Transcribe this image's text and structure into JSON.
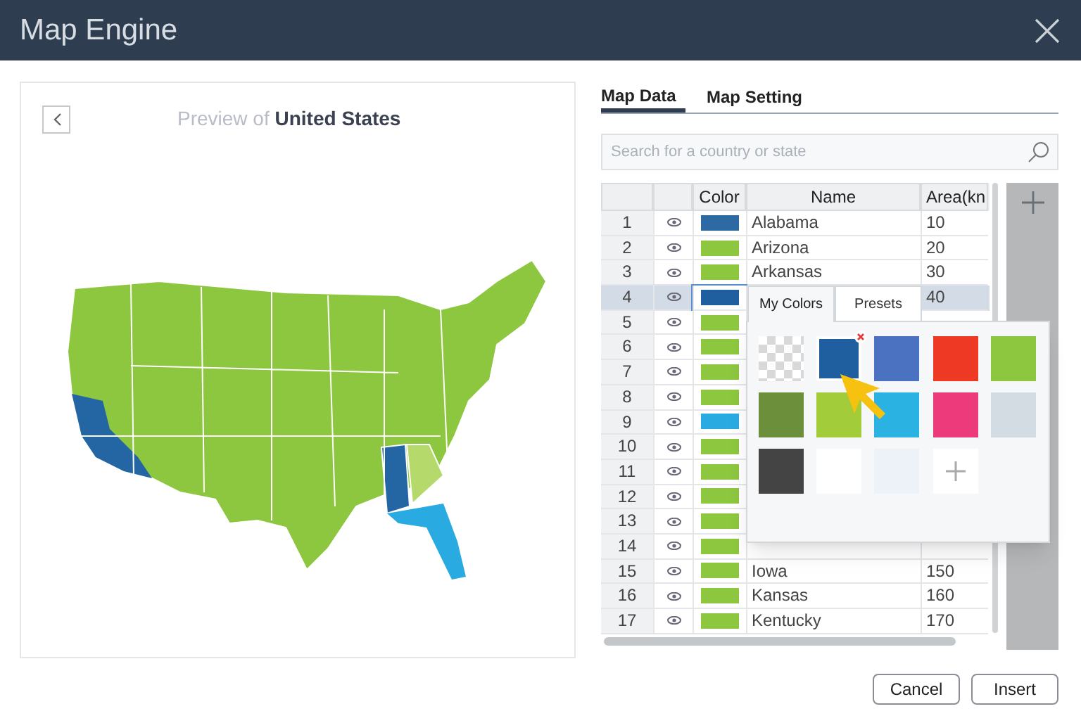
{
  "window": {
    "title": "Map Engine"
  },
  "preview": {
    "prefix": "Preview of",
    "country": "United States"
  },
  "tabs": [
    {
      "label": "Map Data",
      "selected": true
    },
    {
      "label": "Map Setting",
      "selected": false
    }
  ],
  "search": {
    "placeholder": "Search for a country or state"
  },
  "table": {
    "columns": [
      "Color",
      "Name",
      "Area(kn"
    ],
    "rows": [
      {
        "num": "1",
        "color": "#2d6aa3",
        "name": "Alabama",
        "area": "10",
        "selected": false
      },
      {
        "num": "2",
        "color": "#8dc63f",
        "name": "Arizona",
        "area": "20",
        "selected": false
      },
      {
        "num": "3",
        "color": "#8dc63f",
        "name": "Arkansas",
        "area": "30",
        "selected": false
      },
      {
        "num": "4",
        "color": "#1f5fa0",
        "area": "40",
        "selected": true
      },
      {
        "num": "5",
        "color": "#8dc63f",
        "selected": false
      },
      {
        "num": "6",
        "color": "#8dc63f",
        "selected": false
      },
      {
        "num": "7",
        "color": "#8dc63f",
        "selected": false
      },
      {
        "num": "8",
        "color": "#8dc63f",
        "selected": false
      },
      {
        "num": "9",
        "color": "#29abe2",
        "selected": false
      },
      {
        "num": "10",
        "color": "#8dc63f",
        "selected": false
      },
      {
        "num": "11",
        "color": "#8dc63f",
        "selected": false
      },
      {
        "num": "12",
        "color": "#8dc63f",
        "selected": false
      },
      {
        "num": "13",
        "color": "#8dc63f",
        "selected": false
      },
      {
        "num": "14",
        "color": "#8dc63f",
        "selected": false
      },
      {
        "num": "15",
        "color": "#8dc63f",
        "name": "Iowa",
        "area": "150",
        "selected": false
      },
      {
        "num": "16",
        "color": "#8dc63f",
        "name": "Kansas",
        "area": "160",
        "selected": false
      },
      {
        "num": "17",
        "color": "#8dc63f",
        "name": "Kentucky",
        "area": "170",
        "selected": false
      }
    ]
  },
  "color_popover": {
    "tabs": [
      {
        "label": "My Colors",
        "selected": true
      },
      {
        "label": "Presets",
        "selected": false
      }
    ],
    "swatches": [
      {
        "kind": "transparent",
        "selected": false
      },
      {
        "kind": "color",
        "color": "#1f5fa0",
        "selected": true
      },
      {
        "kind": "color",
        "color": "#4a72c0",
        "selected": false
      },
      {
        "kind": "color",
        "color": "#ee3a24",
        "selected": false
      },
      {
        "kind": "color",
        "color": "#8dc63f",
        "selected": false
      },
      {
        "kind": "color",
        "color": "#6b8f3a",
        "selected": false
      },
      {
        "kind": "color",
        "color": "#a2cc3a",
        "selected": false
      },
      {
        "kind": "color",
        "color": "#29b2e2",
        "selected": false
      },
      {
        "kind": "color",
        "color": "#ec3a7b",
        "selected": false
      },
      {
        "kind": "color",
        "color": "#d3dbe3",
        "selected": false
      },
      {
        "kind": "color",
        "color": "#444444",
        "selected": false
      },
      {
        "kind": "color",
        "color": "#ffffff",
        "selected": false
      },
      {
        "kind": "color",
        "color": "#edf2f9",
        "selected": false
      },
      {
        "kind": "add",
        "selected": false
      }
    ]
  },
  "buttons": [
    {
      "label": "Cancel"
    },
    {
      "label": "Insert"
    }
  ]
}
